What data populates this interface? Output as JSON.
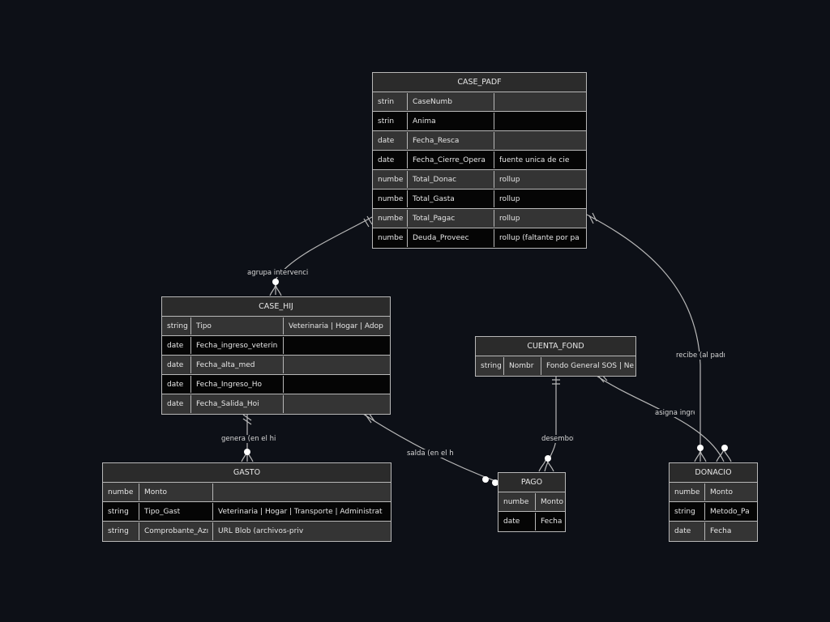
{
  "entities": {
    "case_padre": {
      "title": "CASE_PADF",
      "rows": [
        [
          "strin",
          "CaseNumb",
          ""
        ],
        [
          "strin",
          "Anima",
          ""
        ],
        [
          "date",
          "Fecha_Resca",
          ""
        ],
        [
          "date",
          "Fecha_Cierre_Opera",
          "fuente unica de cie"
        ],
        [
          "numbe",
          "Total_Donac",
          "rollup"
        ],
        [
          "numbe",
          "Total_Gasta",
          "rollup"
        ],
        [
          "numbe",
          "Total_Pagac",
          "rollup"
        ],
        [
          "numbe",
          "Deuda_Proveec",
          "rollup (faltante por pa"
        ]
      ]
    },
    "case_hijo": {
      "title": "CASE_HIJ",
      "rows": [
        [
          "string",
          "Tipo",
          "Veterinaria | Hogar | Adop"
        ],
        [
          "date",
          "Fecha_ingreso_veterin",
          ""
        ],
        [
          "date",
          "Fecha_alta_med",
          ""
        ],
        [
          "date",
          "Fecha_Ingreso_Ho",
          ""
        ],
        [
          "date",
          "Fecha_Salida_Hoi",
          ""
        ]
      ]
    },
    "cuenta_fondo": {
      "title": "CUENTA_FOND",
      "rows": [
        [
          "string",
          "Nombr",
          "Fondo General SOS | Ne"
        ]
      ]
    },
    "gasto": {
      "title": "GASTO",
      "rows": [
        [
          "numbe",
          "Monto",
          ""
        ],
        [
          "string",
          "Tipo_Gast",
          "Veterinaria | Hogar | Transporte | Administrat"
        ],
        [
          "string",
          "Comprobante_Azı",
          "URL Blob (archivos-priv"
        ]
      ]
    },
    "pago": {
      "title": "PAGO",
      "rows": [
        [
          "numbe",
          "Monto"
        ],
        [
          "date",
          "Fecha"
        ]
      ]
    },
    "donacion": {
      "title": "DONACIO",
      "rows": [
        [
          "numbe",
          "Monto"
        ],
        [
          "string",
          "Metodo_Pa"
        ],
        [
          "date",
          "Fecha"
        ]
      ]
    }
  },
  "relationships": {
    "padre_hijo": "agrupa intervencio",
    "padre_donacion": "recibe (al padı",
    "hijo_gasto": "genera (en el hi",
    "hijo_pago": "salda (en el hij",
    "fondo_pago": "desembols",
    "fondo_donacion": "asigna ingre"
  },
  "colors": {
    "background": "#0d1017",
    "line": "#b8b8b8",
    "header": "#2b2b2b",
    "row_light": "#343434",
    "row_dark": "#050505"
  }
}
